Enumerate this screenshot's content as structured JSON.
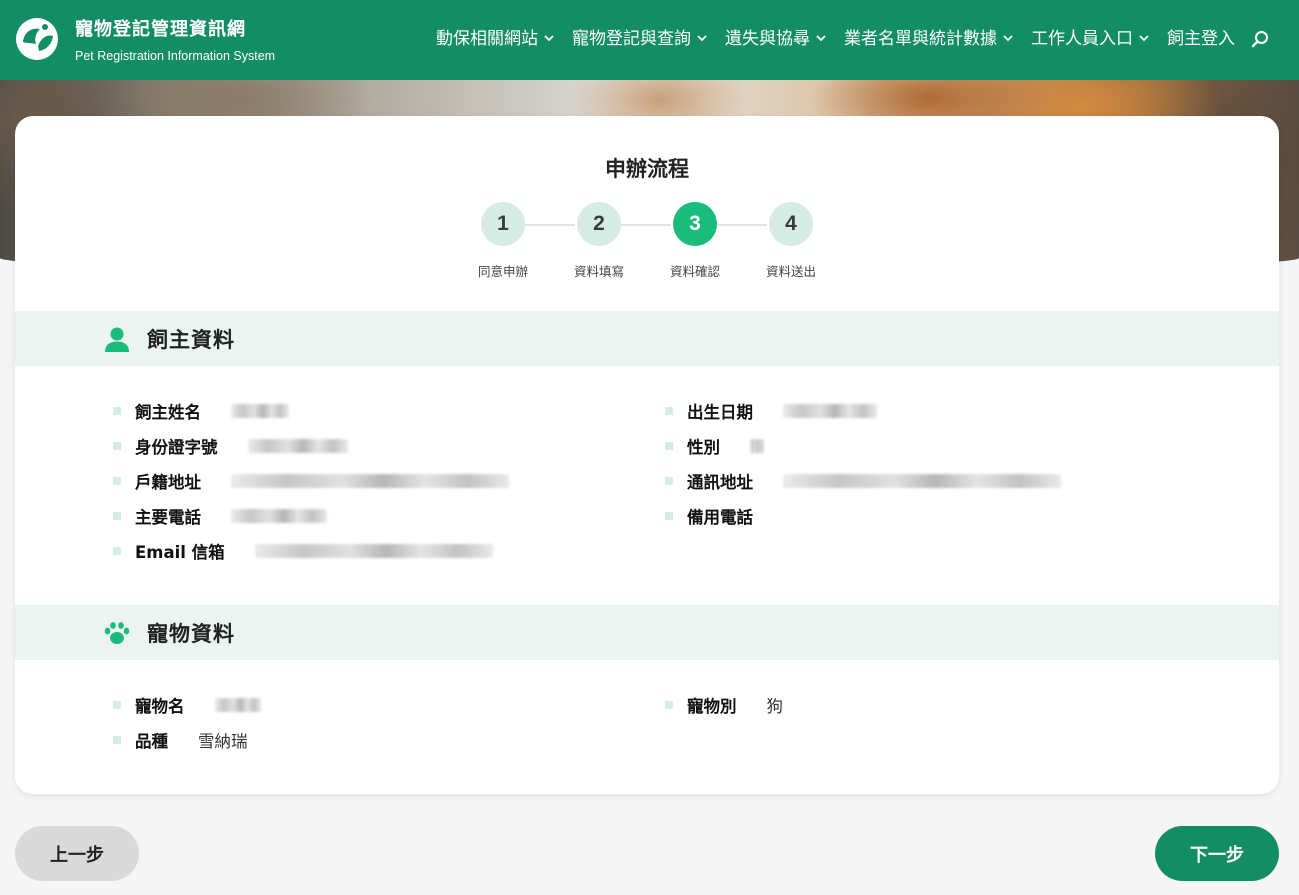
{
  "header": {
    "brand_zh": "寵物登記管理資訊網",
    "brand_en": "Pet Registration Information System",
    "nav": [
      {
        "label": "動保相關網站"
      },
      {
        "label": "寵物登記與查詢"
      },
      {
        "label": "遺失與協尋"
      },
      {
        "label": "業者名單與統計數據"
      },
      {
        "label": "工作人員入口"
      },
      {
        "label": "飼主登入"
      }
    ],
    "icons": {
      "logo": "pet-logo-icon",
      "search": "search-icon",
      "chevron": "chevron-down-icon"
    }
  },
  "flow": {
    "title": "申辦流程",
    "current_step": 3,
    "steps": [
      {
        "number": "1",
        "label": "同意申辦"
      },
      {
        "number": "2",
        "label": "資料填寫"
      },
      {
        "number": "3",
        "label": "資料確認"
      },
      {
        "number": "4",
        "label": "資料送出"
      }
    ]
  },
  "owner": {
    "title": "飼主資料",
    "icon": "user-icon",
    "fields": {
      "name": {
        "label": "飼主姓名"
      },
      "birth": {
        "label": "出生日期"
      },
      "id_no": {
        "label": "身份證字號"
      },
      "gender": {
        "label": "性別"
      },
      "reg_address": {
        "label": "戶籍地址"
      },
      "mail_address": {
        "label": "通訊地址"
      },
      "phone": {
        "label": "主要電話"
      },
      "alt_phone": {
        "label": "備用電話"
      },
      "email": {
        "label": "Email 信箱"
      }
    }
  },
  "pet": {
    "title": "寵物資料",
    "icon": "paw-icon",
    "fields": {
      "name": {
        "label": "寵物名"
      },
      "type": {
        "label": "寵物別",
        "value": "狗"
      },
      "breed": {
        "label": "品種",
        "value": "雪納瑞"
      }
    }
  },
  "buttons": {
    "prev": "上一步",
    "next": "下一步"
  },
  "colors": {
    "primary": "#138d63",
    "accent": "#1abc7c",
    "step_inactive": "#d4ece3",
    "section_bg": "#ebf4f1"
  }
}
